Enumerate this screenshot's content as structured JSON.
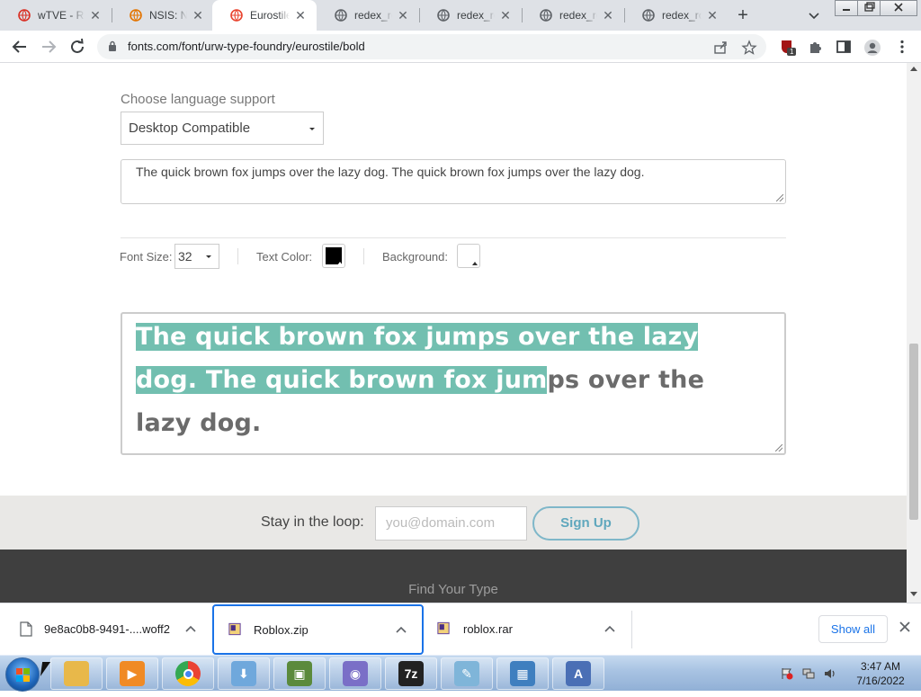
{
  "browser": {
    "tabs": [
      {
        "label": "wTVE - R",
        "icon": "wtve-icon",
        "color": "#d93025",
        "active": false
      },
      {
        "label": "NSIS: Nul",
        "icon": "nsis-icon",
        "color": "#e37400",
        "active": false
      },
      {
        "label": "Eurostile",
        "icon": "fonts-com-icon",
        "color": "#e8432e",
        "active": true
      },
      {
        "label": "redex_rol",
        "icon": "globe-icon",
        "color": "#5f6368",
        "active": false
      },
      {
        "label": "redex_rol",
        "icon": "globe-icon",
        "color": "#5f6368",
        "active": false
      },
      {
        "label": "redex_rol",
        "icon": "globe-icon",
        "color": "#5f6368",
        "active": false
      },
      {
        "label": "redex_rol",
        "icon": "globe-icon",
        "color": "#5f6368",
        "active": false
      }
    ],
    "new_tab": "+",
    "url": "fonts.com/font/urw-type-foundry/eurostile/bold",
    "extension_badge": "1"
  },
  "page": {
    "language": {
      "label": "Choose language support",
      "selected": "Desktop Compatible"
    },
    "sample_text": "The quick brown fox jumps over the lazy dog. The quick brown fox jumps over the lazy dog.",
    "controls": {
      "font_size_label": "Font Size:",
      "font_size_value": "32",
      "text_color_label": "Text Color:",
      "text_color": "#000000",
      "background_label": "Background:",
      "background_color": "#ffffff"
    },
    "preview": {
      "selected_part": "The quick brown fox jumps over the lazy dog. The quick brown fox jum",
      "rest_part": "ps over the lazy dog.",
      "selection_color": "#72bfb0"
    },
    "newsletter": {
      "label": "Stay in the loop:",
      "placeholder": "you@domain.com",
      "button": "Sign Up"
    },
    "footer": {
      "title": "Find Your Type"
    }
  },
  "downloads": {
    "items": [
      {
        "name": "9e8ac0b8-9491-....woff2",
        "icon": "file-icon",
        "selected": false
      },
      {
        "name": "Roblox.zip",
        "icon": "winrar-zip-icon",
        "selected": true
      },
      {
        "name": "roblox.rar",
        "icon": "winrar-icon",
        "selected": false
      }
    ],
    "show_all": "Show all"
  },
  "taskbar": {
    "apps": [
      {
        "name": "file-explorer",
        "icon": "folder-icon",
        "glyph": "",
        "color": "#e8b84a"
      },
      {
        "name": "media-player",
        "icon": "media-player-icon",
        "glyph": "▶",
        "color": "#f08a24"
      },
      {
        "name": "chrome",
        "icon": "chrome-icon",
        "glyph": "",
        "color": "#34a853"
      },
      {
        "name": "installer",
        "icon": "installer-icon",
        "glyph": "⬇",
        "color": "#6fa8dc"
      },
      {
        "name": "setup-tool",
        "icon": "setup-icon",
        "glyph": "▣",
        "color": "#5b8a3c"
      },
      {
        "name": "disc-tool",
        "icon": "disc-icon",
        "glyph": "◉",
        "color": "#7a6fc7"
      },
      {
        "name": "7zip",
        "icon": "7zip-icon",
        "glyph": "7z",
        "color": "#222222"
      },
      {
        "name": "notepad",
        "icon": "notepad-icon",
        "glyph": "✎",
        "color": "#7fb5d9"
      },
      {
        "name": "control-panel",
        "icon": "control-panel-icon",
        "glyph": "▦",
        "color": "#3f7fbf"
      },
      {
        "name": "font-tool",
        "icon": "font-icon",
        "glyph": "A",
        "color": "#4a6fb5"
      }
    ],
    "clock_time": "3:47 AM",
    "clock_date": "7/16/2022"
  }
}
